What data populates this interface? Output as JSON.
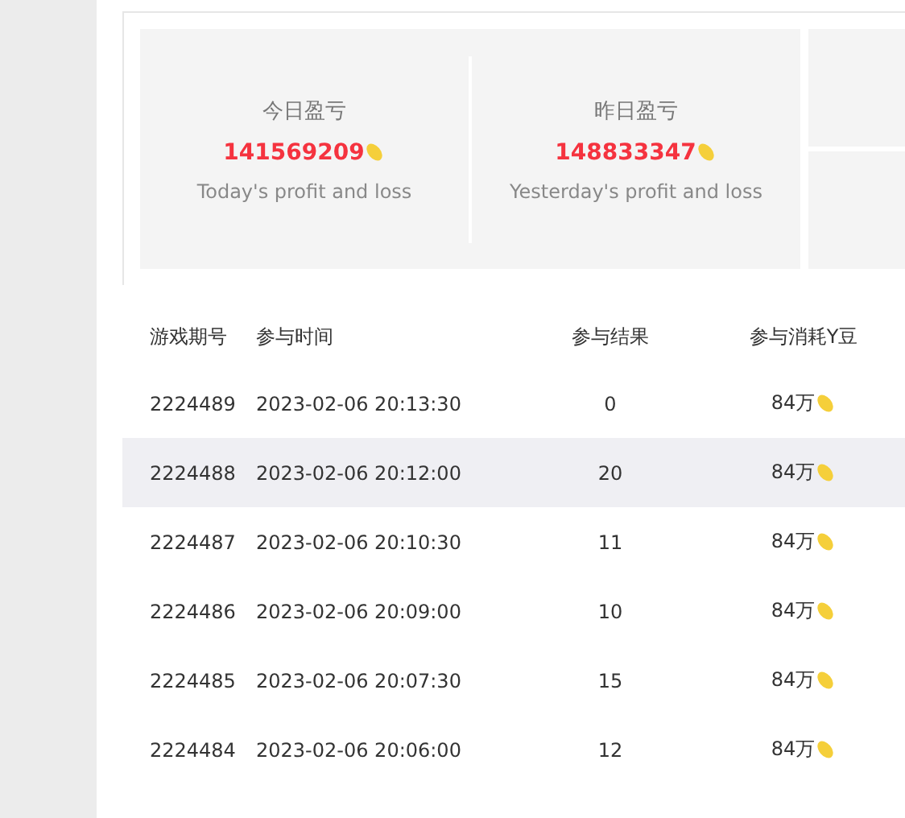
{
  "stats": [
    {
      "title": "今日盈亏",
      "value": "141569209",
      "caption": "Today's profit and loss"
    },
    {
      "title": "昨日盈亏",
      "value": "148833347",
      "caption": "Yesterday's profit and loss"
    }
  ],
  "table": {
    "columns": [
      "游戏期号",
      "参与时间",
      "参与结果",
      "参与消耗Y豆"
    ],
    "rows": [
      {
        "cells": [
          "2224489",
          "2023-02-06 20:13:30",
          "0",
          "84万"
        ],
        "highlighted": false
      },
      {
        "cells": [
          "2224488",
          "2023-02-06 20:12:00",
          "20",
          "84万"
        ],
        "highlighted": true
      },
      {
        "cells": [
          "2224487",
          "2023-02-06 20:10:30",
          "11",
          "84万"
        ],
        "highlighted": false
      },
      {
        "cells": [
          "2224486",
          "2023-02-06 20:09:00",
          "10",
          "84万"
        ],
        "highlighted": false
      },
      {
        "cells": [
          "2224485",
          "2023-02-06 20:07:30",
          "15",
          "84万"
        ],
        "highlighted": false
      },
      {
        "cells": [
          "2224484",
          "2023-02-06 20:06:00",
          "12",
          "84万"
        ],
        "highlighted": false
      }
    ]
  }
}
